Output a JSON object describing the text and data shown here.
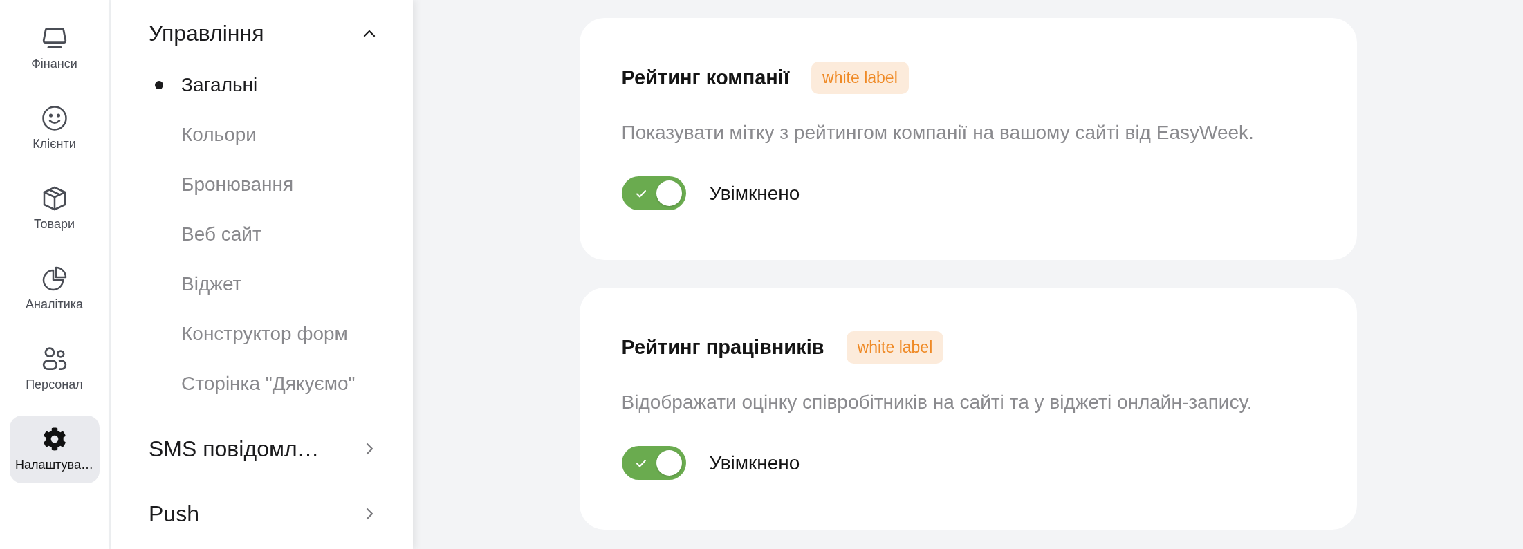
{
  "nav_rail": {
    "items": [
      {
        "label": "Фінанси",
        "selected": false
      },
      {
        "label": "Клієнти",
        "selected": false
      },
      {
        "label": "Товари",
        "selected": false
      },
      {
        "label": "Аналітика",
        "selected": false
      },
      {
        "label": "Персонал",
        "selected": false
      },
      {
        "label": "Налаштува…",
        "selected": true
      }
    ]
  },
  "sidebar": {
    "sections": [
      {
        "title": "Управління",
        "expanded": true,
        "children": [
          {
            "label": "Загальні",
            "selected": true
          },
          {
            "label": "Кольори",
            "selected": false
          },
          {
            "label": "Бронювання",
            "selected": false
          },
          {
            "label": "Веб сайт",
            "selected": false
          },
          {
            "label": "Віджет",
            "selected": false
          },
          {
            "label": "Конструктор форм",
            "selected": false
          },
          {
            "label": "Сторінка \"Дякуємо\"",
            "selected": false
          }
        ]
      },
      {
        "title": "SMS повідомл…",
        "expanded": false
      },
      {
        "title": "Push",
        "expanded": false
      }
    ]
  },
  "cards": [
    {
      "title": "Рейтинг компанії",
      "badge": "white label",
      "description": "Показувати мітку з рейтингом компанії на вашому сайті від EasyWeek.",
      "toggle": {
        "on": true,
        "label": "Увімкнено"
      }
    },
    {
      "title": "Рейтинг працівників",
      "badge": "white label",
      "description": "Відображати оцінку співробітників на сайті та у віджеті онлайн-запису.",
      "toggle": {
        "on": true,
        "label": "Увімкнено"
      }
    }
  ]
}
